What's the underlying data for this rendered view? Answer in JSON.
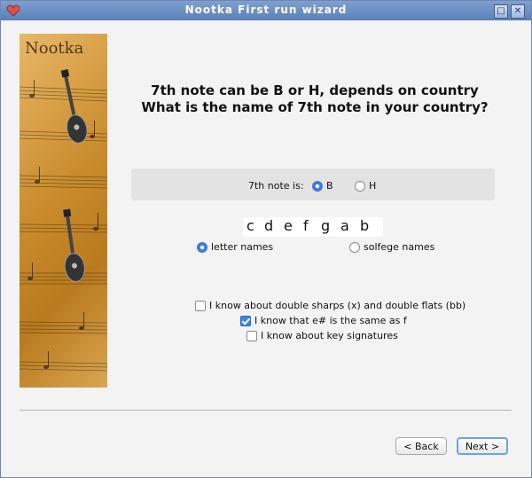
{
  "window": {
    "title": "Nootka First run wizard"
  },
  "heading": {
    "line1": "7th note can be B or H, depends on country",
    "line2": "What is the name of 7th note in your country?"
  },
  "seventh_note": {
    "label": "7th note is:",
    "options": [
      {
        "label": "B",
        "selected": true
      },
      {
        "label": "H",
        "selected": false
      }
    ]
  },
  "note_preview": [
    "c",
    "d",
    "e",
    "f",
    "g",
    "a",
    "b"
  ],
  "naming": {
    "options": [
      {
        "label": "letter names",
        "selected": true
      },
      {
        "label": "solfege names",
        "selected": false
      }
    ]
  },
  "checkboxes": [
    {
      "label": "I know about double sharps (x) and double flats (bb)",
      "checked": false
    },
    {
      "label": "I know that e# is the same as f",
      "checked": true
    },
    {
      "label": "I know about key signatures",
      "checked": false
    }
  ],
  "buttons": {
    "back": "< Back",
    "next": "Next >"
  },
  "side_image": {
    "caption": "Nootka"
  },
  "colors": {
    "accent": "#3a7ae0",
    "titlebar": "#5b7fb8",
    "image": "#c98b2c"
  }
}
